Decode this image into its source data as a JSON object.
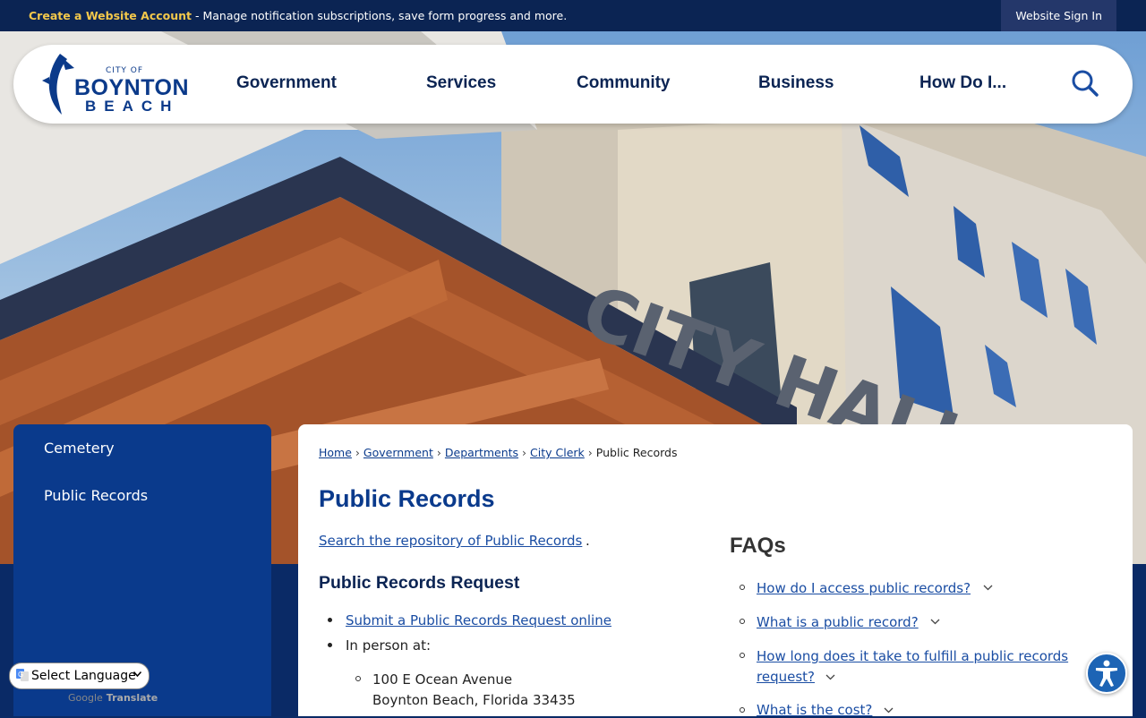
{
  "topbar": {
    "account_link": "Create a Website Account",
    "account_text": " - Manage notification subscriptions, save form progress and more.",
    "sign_in": "Website Sign In"
  },
  "logo": {
    "city_of": "CITY OF",
    "boynton": "BOYNTON",
    "beach": "BEACH"
  },
  "nav": [
    "Government",
    "Services",
    "Community",
    "Business",
    "How Do I..."
  ],
  "sidebar": {
    "items": [
      "Cemetery",
      "Public Records"
    ]
  },
  "breadcrumb": {
    "items": [
      "Home",
      "Government",
      "Departments",
      "City Clerk"
    ],
    "current": "Public Records",
    "separator": "›"
  },
  "page": {
    "title": "Public Records",
    "search_link": "Search the repository of Public Records",
    "search_suffix": ".",
    "request_heading": "Public Records Request",
    "request_online": "Submit a Public Records Request online",
    "in_person": "In person at:",
    "address_line1": "100 E Ocean Avenue",
    "address_line2": "Boynton Beach, Florida 33435"
  },
  "faqs": {
    "heading": "FAQs",
    "items": [
      "How do I access public records?",
      "What is a public record?",
      "How long does it take to fulfill a public records",
      "request?",
      "What is the cost?"
    ]
  },
  "translate": {
    "select_label": "Select Language",
    "powered_by": "Google",
    "translate": "Translate"
  },
  "colors": {
    "navy": "#0b2453",
    "brand_blue": "#0a3a8c",
    "gold": "#f3c84b",
    "link": "#1a4da3"
  }
}
